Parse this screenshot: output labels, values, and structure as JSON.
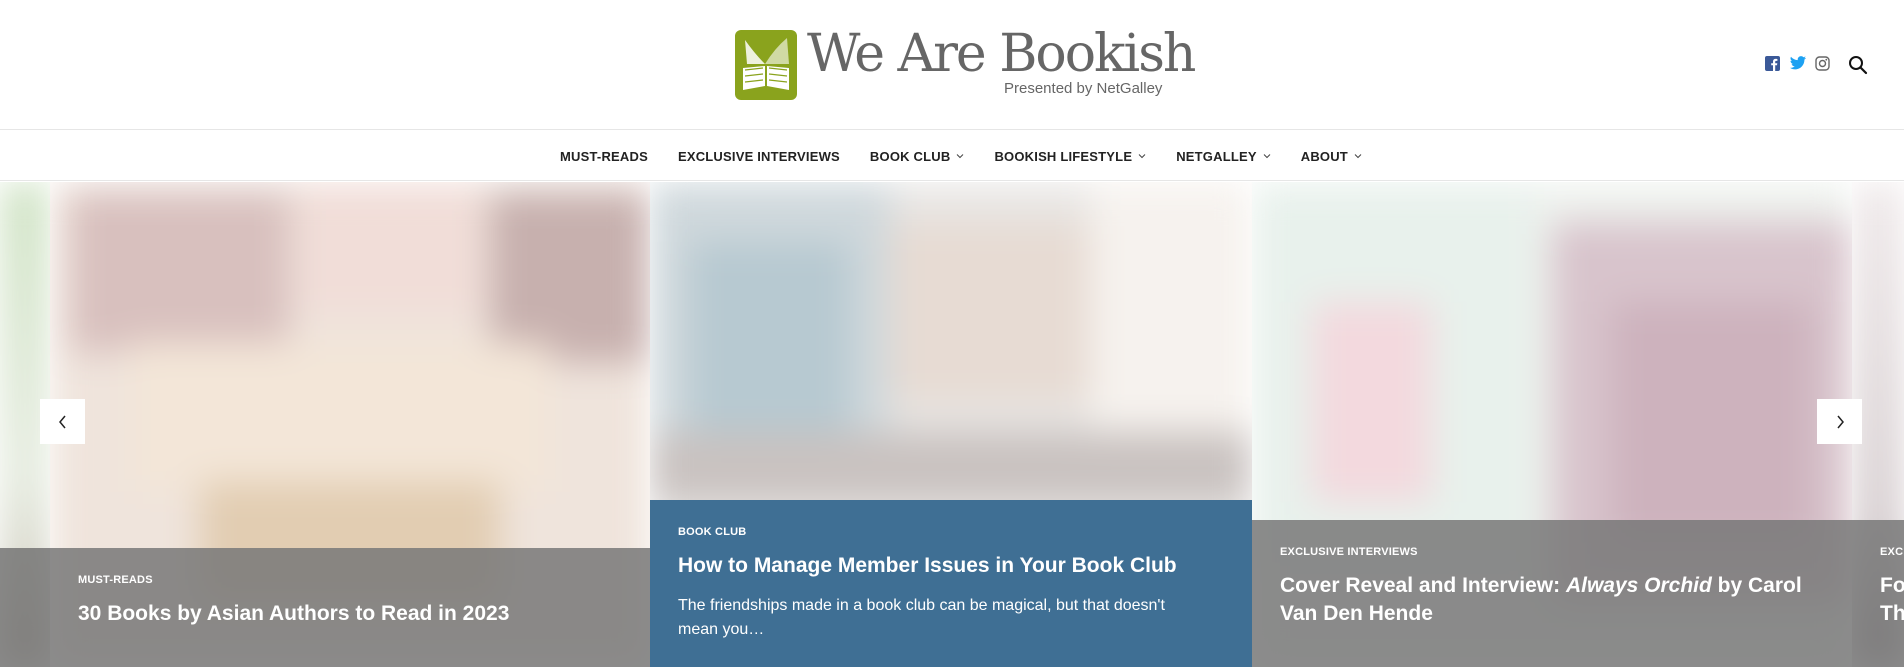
{
  "site": {
    "logo_title": "We Are Bookish",
    "logo_subtitle": "Presented by NetGalley"
  },
  "social": [
    {
      "name": "facebook-icon",
      "color": "#3b5998"
    },
    {
      "name": "twitter-icon",
      "color": "#1da1f2"
    },
    {
      "name": "instagram-icon",
      "color": "#666666"
    }
  ],
  "nav": {
    "items": [
      {
        "label": "MUST-READS",
        "has_dropdown": false
      },
      {
        "label": "EXCLUSIVE INTERVIEWS",
        "has_dropdown": false
      },
      {
        "label": "BOOK CLUB",
        "has_dropdown": true
      },
      {
        "label": "BOOKISH LIFESTYLE",
        "has_dropdown": true
      },
      {
        "label": "NETGALLEY",
        "has_dropdown": true
      },
      {
        "label": "ABOUT",
        "has_dropdown": true
      }
    ]
  },
  "slides": [
    {
      "category": "MUST-READS",
      "title": "30 Books by Asian Authors to Read in 2023",
      "excerpt": ""
    },
    {
      "category": "BOOK CLUB",
      "title": "How to Manage Member Issues in Your Book Club",
      "excerpt": "The friendships made in a book club can be magical, but that doesn't mean you…"
    },
    {
      "category": "EXCLUSIVE INTERVIEWS",
      "title_pre": "Cover Reveal and Interview: ",
      "title_em": "Always Orchid",
      "title_post": " by Carol Van Den Hende",
      "excerpt": ""
    },
    {
      "category": "EXCL",
      "title_line1": "Fo",
      "title_line2": "Th"
    }
  ],
  "colors": {
    "brand_green": "#8aa31d",
    "active_caption": "#3f6f94",
    "caption_gray": "#7a7a7a"
  }
}
